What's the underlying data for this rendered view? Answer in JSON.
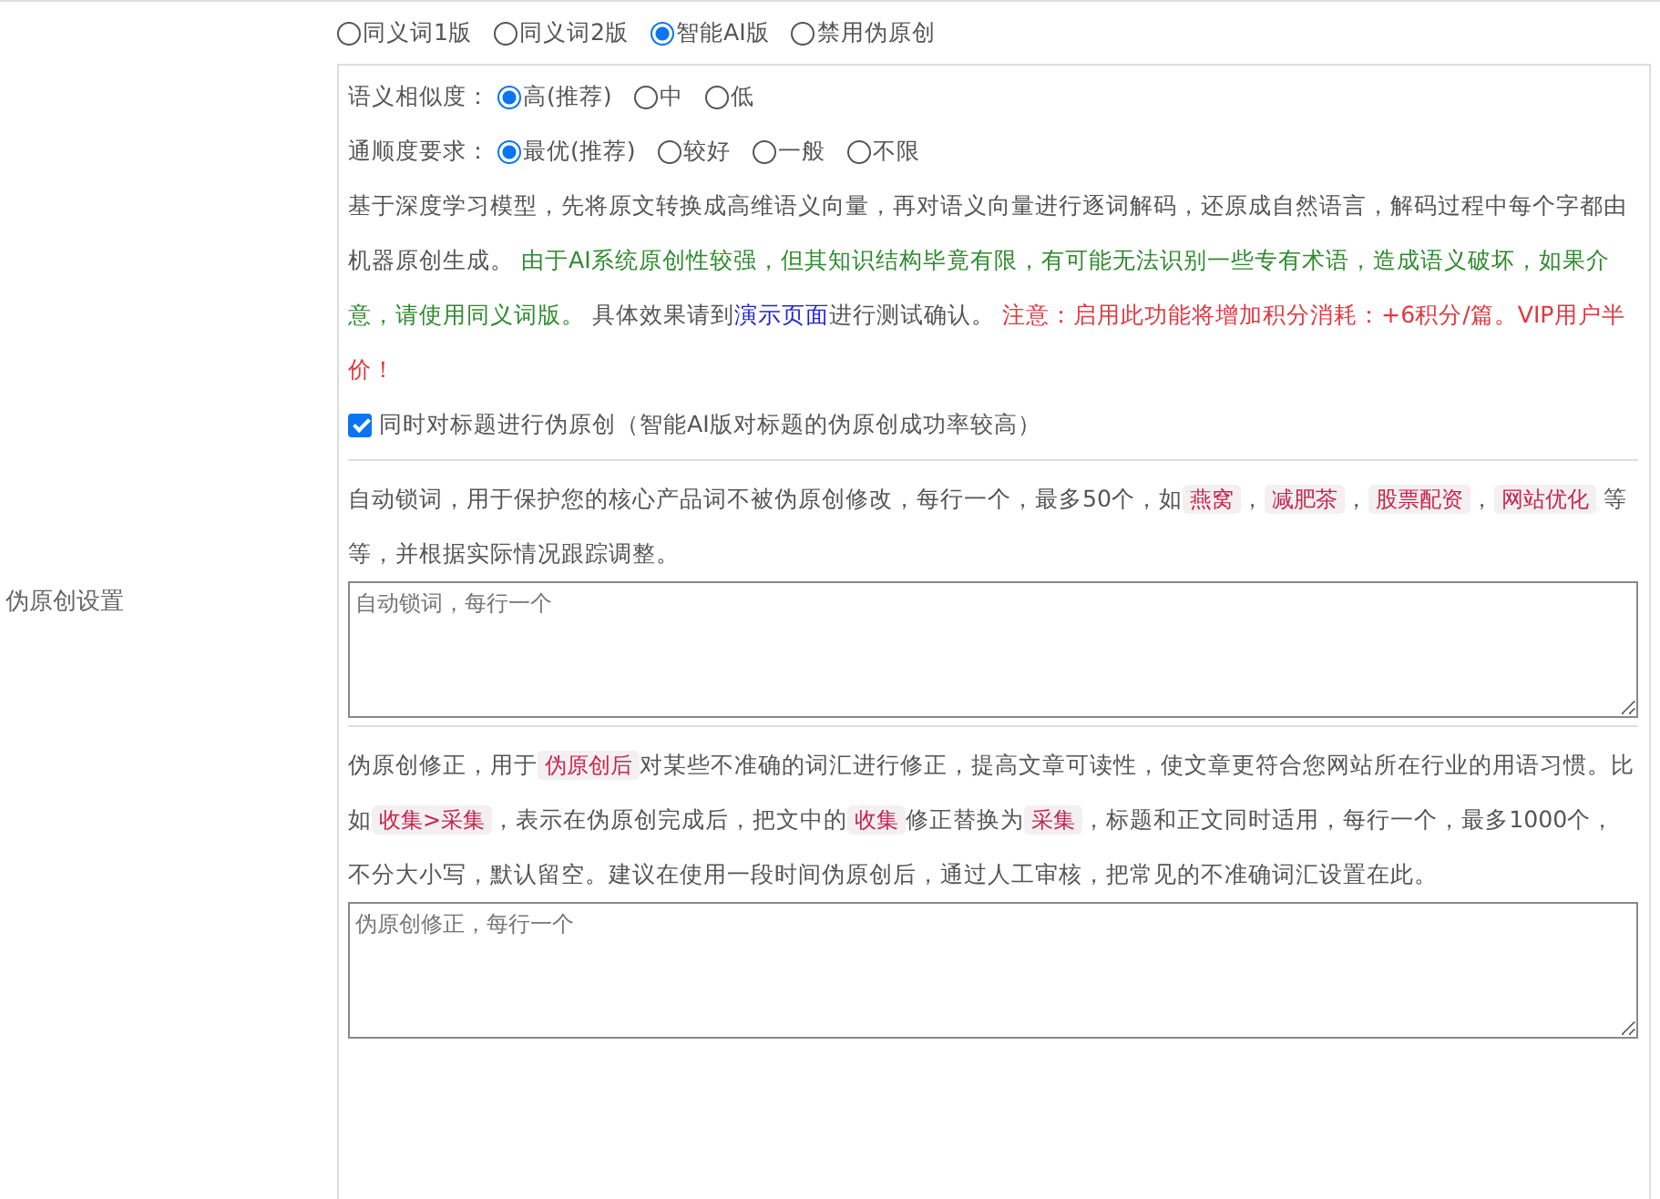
{
  "version_options": [
    {
      "label": "同义词1版",
      "selected": false
    },
    {
      "label": "同义词2版",
      "selected": false
    },
    {
      "label": "智能AI版",
      "selected": true
    },
    {
      "label": "禁用伪原创",
      "selected": false
    }
  ],
  "row_label": "伪原创设置",
  "similarity": {
    "label": "语义相似度：",
    "options": [
      {
        "label": "高(推荐)",
        "selected": true
      },
      {
        "label": "中",
        "selected": false
      },
      {
        "label": "低",
        "selected": false
      }
    ]
  },
  "fluency": {
    "label": "通顺度要求：",
    "options": [
      {
        "label": "最优(推荐)",
        "selected": true
      },
      {
        "label": "较好",
        "selected": false
      },
      {
        "label": "一般",
        "selected": false
      },
      {
        "label": "不限",
        "selected": false
      }
    ]
  },
  "description": [
    {
      "kind": "plain",
      "text": "基于深度学习模型，先将原文转换成高维语义向量，再对语义向量进行逐词解码，还原成自然语言，解码过程中每个字都由机器原创生成。 "
    },
    {
      "kind": "green",
      "text": "由于AI系统原创性较强，但其知识结构毕竟有限，有可能无法识别一些专有术语，造成语义破坏，如果介意，请使用同义词版。"
    },
    {
      "kind": "plain",
      "text": " 具体效果请到"
    },
    {
      "kind": "link",
      "text": "演示页面"
    },
    {
      "kind": "plain",
      "text": "进行测试确认。 "
    },
    {
      "kind": "red",
      "text": "注意：启用此功能将增加积分消耗：+6积分/篇。VIP用户半价！"
    }
  ],
  "title_option": {
    "label": "同时对标题进行伪原创（智能AI版对标题的伪原创成功率较高）",
    "checked": true
  },
  "lock_words": {
    "description": [
      {
        "kind": "plain",
        "text": "自动锁词，用于保护您的核心产品词不被伪原创修改，每行一个，最多50个，如"
      },
      {
        "kind": "code",
        "text": "燕窝"
      },
      {
        "kind": "plain",
        "text": "，"
      },
      {
        "kind": "code",
        "text": "减肥茶"
      },
      {
        "kind": "plain",
        "text": "，"
      },
      {
        "kind": "code",
        "text": "股票配资"
      },
      {
        "kind": "plain",
        "text": "，"
      },
      {
        "kind": "code",
        "text": "网站优化"
      },
      {
        "kind": "plain",
        "text": " 等等，并根据实际情况跟踪调整。"
      }
    ],
    "placeholder": "自动锁词，每行一个"
  },
  "corrections": {
    "description": [
      {
        "kind": "plain",
        "text": "伪原创修正，用于"
      },
      {
        "kind": "code",
        "text": "伪原创后"
      },
      {
        "kind": "plain",
        "text": "对某些不准确的词汇进行修正，提高文章可读性，使文章更符合您网站所在行业的用语习惯。比如"
      },
      {
        "kind": "code",
        "text": "收集>采集"
      },
      {
        "kind": "plain",
        "text": "，表示在伪原创完成后，把文中的"
      },
      {
        "kind": "code",
        "text": "收集"
      },
      {
        "kind": "plain",
        "text": "修正替换为"
      },
      {
        "kind": "code",
        "text": "采集"
      },
      {
        "kind": "plain",
        "text": "，标题和正文同时适用，每行一个，最多1000个，不分大小写，默认留空。建议在使用一段时间伪原创后，通过人工审核，把常见的不准确词汇设置在此。"
      }
    ],
    "placeholder": "伪原创修正，每行一个"
  }
}
